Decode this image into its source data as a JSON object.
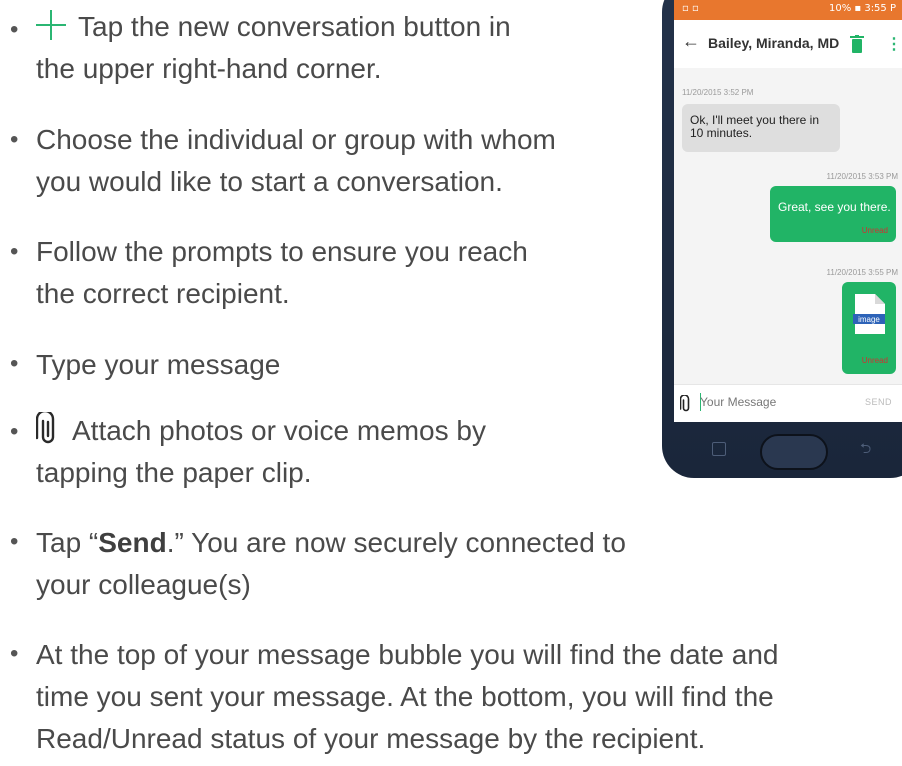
{
  "instructions": {
    "bullet": "•",
    "items": [
      {
        "line1": "Tap the new conversation button in",
        "line2": "the upper right-hand corner.",
        "icon": "plus-icon"
      },
      {
        "line1": "Choose the individual or group with whom",
        "line2": "you would like to start a conversation."
      },
      {
        "line1": "Follow the prompts to ensure you reach",
        "line2": "the correct recipient."
      },
      {
        "line1": "Type your message"
      },
      {
        "line1": "Attach photos or voice memos by",
        "line2": "tapping the paper clip.",
        "icon": "paperclip-icon"
      },
      {
        "prefix": "Tap “",
        "bold": "Send",
        "suffix": ".” You are now securely connected to",
        "line2": "your colleague(s)"
      },
      {
        "line1": "At the top of your message bubble you will find the date and",
        "line2": "time you sent your message. At the bottom, you will find the",
        "line3": "Read/Unread status of your message by the recipient."
      }
    ]
  },
  "phone": {
    "status_right": "10% ▪ 3:55 P",
    "contact_name": "Bailey, Miranda, MD",
    "messages": [
      {
        "timestamp": "11/20/2015 3:52 PM",
        "text": "Ok, I'll meet you there in 10 minutes."
      },
      {
        "timestamp": "11/20/2015 3:53 PM",
        "text": "Great, see you there.",
        "status": "Unread"
      },
      {
        "timestamp": "11/20/2015 3:55 PM",
        "attachment_label": "image",
        "status": "Unread"
      }
    ],
    "composer_placeholder": "Your Message",
    "send_label": "SEND"
  },
  "colors": {
    "accent_green": "#21b466",
    "status_bar": "#e8772e",
    "unread_red": "#cc3333",
    "phone_body": "#1a263a"
  }
}
